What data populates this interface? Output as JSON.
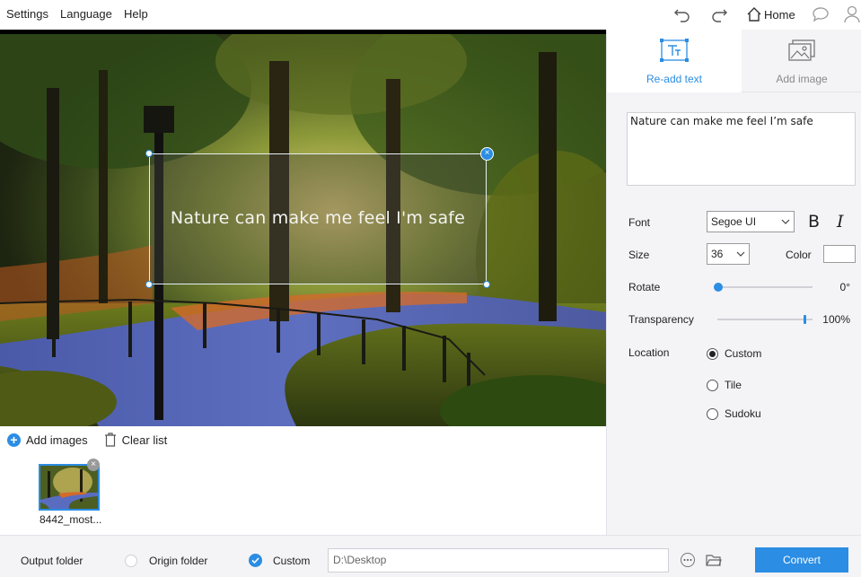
{
  "menu": {
    "settings": "Settings",
    "language": "Language",
    "help": "Help"
  },
  "toolbar": {
    "home_label": "Home"
  },
  "canvas": {
    "overlay_text": "Nature can make me feel I'm safe"
  },
  "list": {
    "add_images_label": "Add images",
    "clear_list_label": "Clear list",
    "thumbnails": [
      {
        "name": "8442_most..."
      }
    ]
  },
  "panel": {
    "tabs": [
      {
        "label": "Re-add text",
        "active": true
      },
      {
        "label": "Add image",
        "active": false
      }
    ],
    "text_value": "Nature can make me feel I’m safe",
    "font": {
      "label": "Font",
      "value": "Segoe UI",
      "bold_label": "B",
      "italic_label": "I"
    },
    "size": {
      "label": "Size",
      "value": "36"
    },
    "color": {
      "label": "Color",
      "value": "#ffffff"
    },
    "rotate": {
      "label": "Rotate",
      "value": 0,
      "display": "0°"
    },
    "transparency": {
      "label": "Transparency",
      "value": 100,
      "display": "100%"
    },
    "location": {
      "label": "Location",
      "options": [
        {
          "label": "Custom",
          "checked": true
        },
        {
          "label": "Tile",
          "checked": false
        },
        {
          "label": "Sudoku",
          "checked": false
        }
      ]
    }
  },
  "footer": {
    "output_folder_label": "Output folder",
    "origin_folder_label": "Origin folder",
    "custom_label": "Custom",
    "custom_selected": true,
    "path_value": "D:\\Desktop",
    "convert_label": "Convert"
  },
  "colors": {
    "accent": "#2b8de3",
    "panel_bg": "#f4f4f7"
  }
}
